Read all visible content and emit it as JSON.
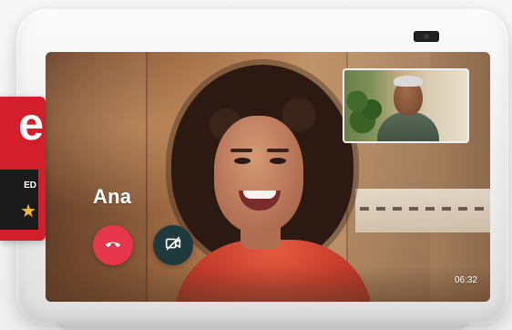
{
  "call": {
    "caller_name": "Ana",
    "timer": "06:32"
  },
  "controls": {
    "end_call_icon": "phone-hangup-icon",
    "video_off_icon": "video-off-icon"
  },
  "badge": {
    "letter": "e",
    "text": "ED",
    "star": "★"
  },
  "colors": {
    "end_call_button": "#e5364b",
    "video_button": "#1f3a3c",
    "badge_red": "#d31f2b"
  }
}
